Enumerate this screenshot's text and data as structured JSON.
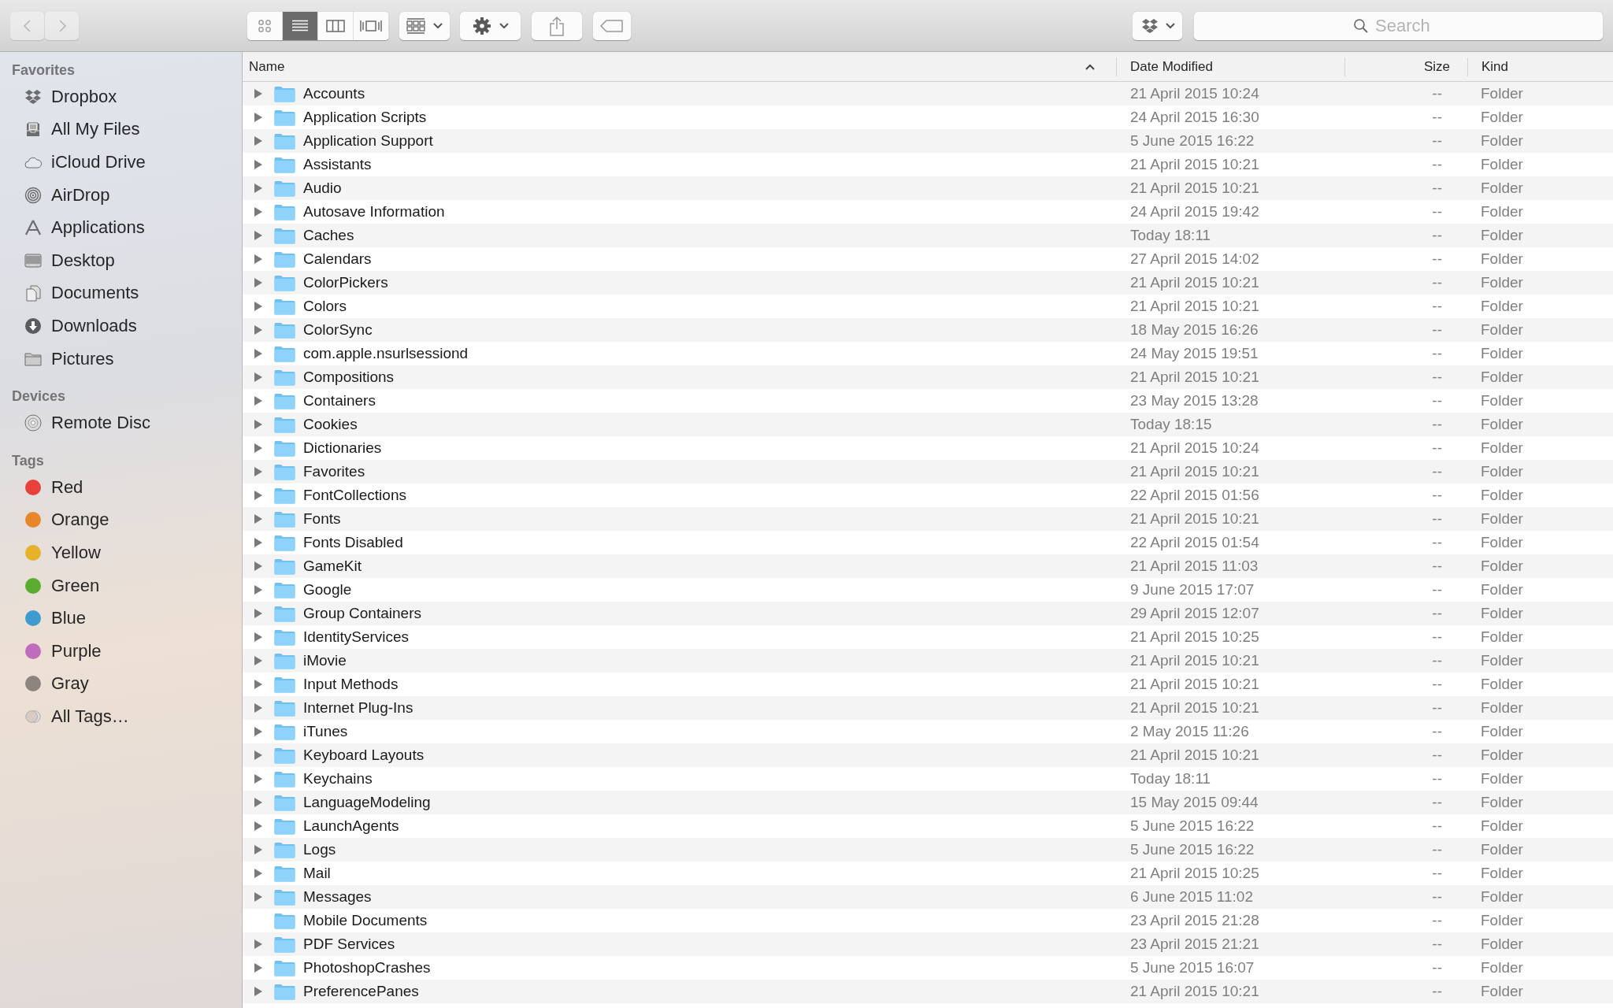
{
  "toolbar": {
    "back": {
      "disabled": true
    },
    "forward": {
      "disabled": true
    },
    "view_modes": [
      {
        "selected": false
      },
      {
        "selected": true
      },
      {
        "selected": false
      },
      {
        "selected": false
      }
    ],
    "search": {
      "placeholder": "Search"
    }
  },
  "sidebar": {
    "sections": [
      {
        "kind": "places",
        "title": "Favorites",
        "items": [
          {
            "label": "Dropbox"
          },
          {
            "label": "All My Files"
          },
          {
            "label": "iCloud Drive"
          },
          {
            "label": "AirDrop"
          },
          {
            "label": "Applications"
          },
          {
            "label": "Desktop"
          },
          {
            "label": "Documents"
          },
          {
            "label": "Downloads"
          },
          {
            "label": "Pictures"
          }
        ]
      },
      {
        "kind": "devices",
        "title": "Devices",
        "items": [
          {
            "label": "Remote Disc"
          }
        ]
      },
      {
        "kind": "tags",
        "title": "Tags",
        "items": [
          {
            "label": "Red",
            "color": "#e8403a"
          },
          {
            "label": "Orange",
            "color": "#e8862a"
          },
          {
            "label": "Yellow",
            "color": "#e6b22a"
          },
          {
            "label": "Green",
            "color": "#5bab2e"
          },
          {
            "label": "Blue",
            "color": "#3d9bd0"
          },
          {
            "label": "Purple",
            "color": "#c06cbd"
          },
          {
            "label": "Gray",
            "color": "#8d857d"
          },
          {
            "label": "All Tags…",
            "kind": "all"
          }
        ]
      }
    ]
  },
  "table": {
    "columns": [
      {
        "label": "Name",
        "sorted": true
      },
      {
        "label": "Date Modified",
        "sorted": false
      },
      {
        "label": "Size",
        "sorted": false
      },
      {
        "label": "Kind",
        "sorted": false
      }
    ],
    "rows": [
      {
        "name": "Accounts",
        "date": "21 April 2015 10:24",
        "size": "--",
        "kind": "Folder",
        "expandable": true
      },
      {
        "name": "Application Scripts",
        "date": "24 April 2015 16:30",
        "size": "--",
        "kind": "Folder",
        "expandable": true
      },
      {
        "name": "Application Support",
        "date": "5 June 2015 16:22",
        "size": "--",
        "kind": "Folder",
        "expandable": true
      },
      {
        "name": "Assistants",
        "date": "21 April 2015 10:21",
        "size": "--",
        "kind": "Folder",
        "expandable": true
      },
      {
        "name": "Audio",
        "date": "21 April 2015 10:21",
        "size": "--",
        "kind": "Folder",
        "expandable": true
      },
      {
        "name": "Autosave Information",
        "date": "24 April 2015 19:42",
        "size": "--",
        "kind": "Folder",
        "expandable": true
      },
      {
        "name": "Caches",
        "date": "Today 18:11",
        "size": "--",
        "kind": "Folder",
        "expandable": true
      },
      {
        "name": "Calendars",
        "date": "27 April 2015 14:02",
        "size": "--",
        "kind": "Folder",
        "expandable": true
      },
      {
        "name": "ColorPickers",
        "date": "21 April 2015 10:21",
        "size": "--",
        "kind": "Folder",
        "expandable": true
      },
      {
        "name": "Colors",
        "date": "21 April 2015 10:21",
        "size": "--",
        "kind": "Folder",
        "expandable": true
      },
      {
        "name": "ColorSync",
        "date": "18 May 2015 16:26",
        "size": "--",
        "kind": "Folder",
        "expandable": true
      },
      {
        "name": "com.apple.nsurlsessiond",
        "date": "24 May 2015 19:51",
        "size": "--",
        "kind": "Folder",
        "expandable": true
      },
      {
        "name": "Compositions",
        "date": "21 April 2015 10:21",
        "size": "--",
        "kind": "Folder",
        "expandable": true
      },
      {
        "name": "Containers",
        "date": "23 May 2015 13:28",
        "size": "--",
        "kind": "Folder",
        "expandable": true
      },
      {
        "name": "Cookies",
        "date": "Today 18:15",
        "size": "--",
        "kind": "Folder",
        "expandable": true
      },
      {
        "name": "Dictionaries",
        "date": "21 April 2015 10:24",
        "size": "--",
        "kind": "Folder",
        "expandable": true
      },
      {
        "name": "Favorites",
        "date": "21 April 2015 10:21",
        "size": "--",
        "kind": "Folder",
        "expandable": true
      },
      {
        "name": "FontCollections",
        "date": "22 April 2015 01:56",
        "size": "--",
        "kind": "Folder",
        "expandable": true
      },
      {
        "name": "Fonts",
        "date": "21 April 2015 10:21",
        "size": "--",
        "kind": "Folder",
        "expandable": true
      },
      {
        "name": "Fonts Disabled",
        "date": "22 April 2015 01:54",
        "size": "--",
        "kind": "Folder",
        "expandable": true
      },
      {
        "name": "GameKit",
        "date": "21 April 2015 11:03",
        "size": "--",
        "kind": "Folder",
        "expandable": true
      },
      {
        "name": "Google",
        "date": "9 June 2015 17:07",
        "size": "--",
        "kind": "Folder",
        "expandable": true
      },
      {
        "name": "Group Containers",
        "date": "29 April 2015 12:07",
        "size": "--",
        "kind": "Folder",
        "expandable": true
      },
      {
        "name": "IdentityServices",
        "date": "21 April 2015 10:25",
        "size": "--",
        "kind": "Folder",
        "expandable": true
      },
      {
        "name": "iMovie",
        "date": "21 April 2015 10:21",
        "size": "--",
        "kind": "Folder",
        "expandable": true
      },
      {
        "name": "Input Methods",
        "date": "21 April 2015 10:21",
        "size": "--",
        "kind": "Folder",
        "expandable": true
      },
      {
        "name": "Internet Plug-Ins",
        "date": "21 April 2015 10:21",
        "size": "--",
        "kind": "Folder",
        "expandable": true
      },
      {
        "name": "iTunes",
        "date": "2 May 2015 11:26",
        "size": "--",
        "kind": "Folder",
        "expandable": true
      },
      {
        "name": "Keyboard Layouts",
        "date": "21 April 2015 10:21",
        "size": "--",
        "kind": "Folder",
        "expandable": true
      },
      {
        "name": "Keychains",
        "date": "Today 18:11",
        "size": "--",
        "kind": "Folder",
        "expandable": true
      },
      {
        "name": "LanguageModeling",
        "date": "15 May 2015 09:44",
        "size": "--",
        "kind": "Folder",
        "expandable": true
      },
      {
        "name": "LaunchAgents",
        "date": "5 June 2015 16:22",
        "size": "--",
        "kind": "Folder",
        "expandable": true
      },
      {
        "name": "Logs",
        "date": "5 June 2015 16:22",
        "size": "--",
        "kind": "Folder",
        "expandable": true
      },
      {
        "name": "Mail",
        "date": "21 April 2015 10:25",
        "size": "--",
        "kind": "Folder",
        "expandable": true
      },
      {
        "name": "Messages",
        "date": "6 June 2015 11:02",
        "size": "--",
        "kind": "Folder",
        "expandable": true
      },
      {
        "name": "Mobile Documents",
        "date": "23 April 2015 21:28",
        "size": "--",
        "kind": "Folder",
        "expandable": false
      },
      {
        "name": "PDF Services",
        "date": "23 April 2015 21:21",
        "size": "--",
        "kind": "Folder",
        "expandable": true
      },
      {
        "name": "PhotoshopCrashes",
        "date": "5 June 2015 16:07",
        "size": "--",
        "kind": "Folder",
        "expandable": true
      },
      {
        "name": "PreferencePanes",
        "date": "21 April 2015 10:21",
        "size": "--",
        "kind": "Folder",
        "expandable": true
      }
    ]
  }
}
